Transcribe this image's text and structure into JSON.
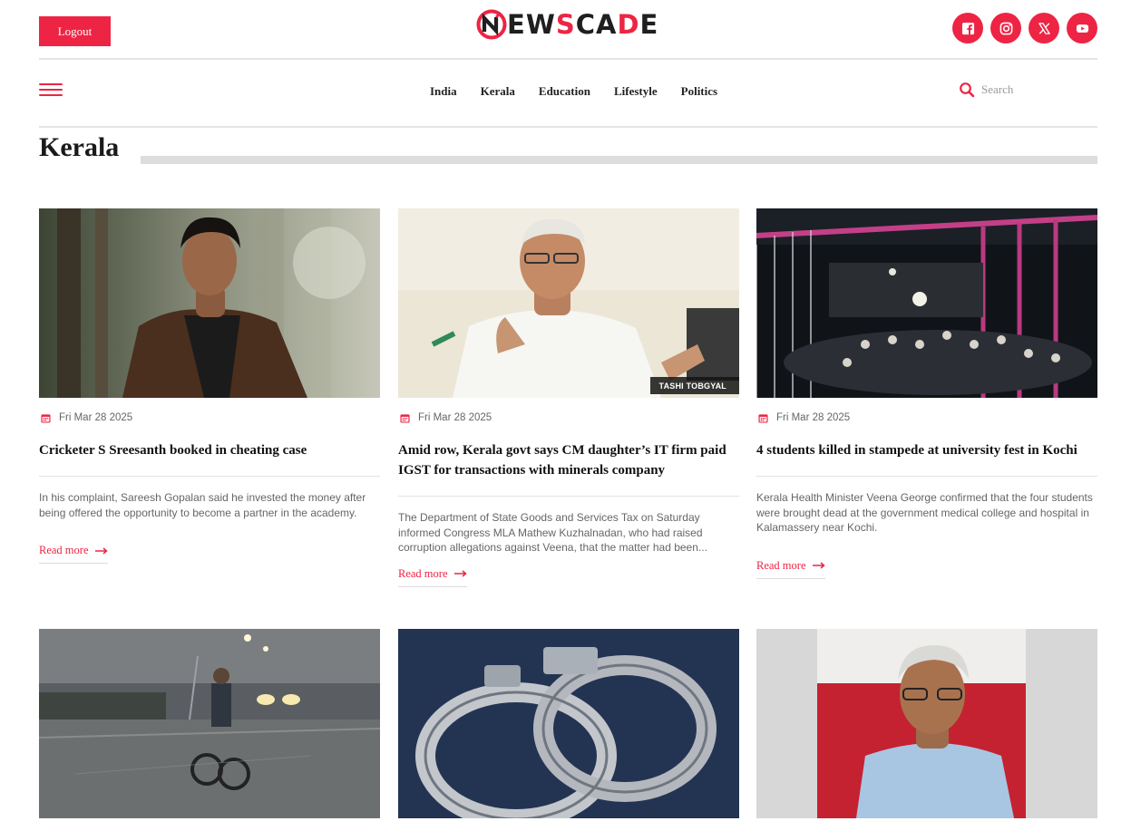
{
  "header": {
    "logout_label": "Logout",
    "logo_letters": [
      "N",
      "E",
      "W",
      "S",
      "C",
      "A",
      "D",
      "E"
    ],
    "socials": [
      "facebook-icon",
      "instagram-icon",
      "x-icon",
      "youtube-icon"
    ]
  },
  "nav": {
    "links": [
      "India",
      "Kerala",
      "Education",
      "Lifestyle",
      "Politics"
    ],
    "search_placeholder": "Search"
  },
  "section": {
    "title": "Kerala"
  },
  "articles": [
    {
      "date": "Fri Mar 28 2025",
      "title": "Cricketer S Sreesanth booked in cheating case",
      "excerpt": "In his complaint, Sareesh Gopalan said he invested the money after being offered the opportunity to become a partner in the academy.",
      "read_more": "Read more",
      "image": "man-in-leather-jacket-forest"
    },
    {
      "date": "Fri Mar 28 2025",
      "title": "Amid row, Kerala govt says CM daughter’s IT firm paid IGST for transactions with minerals company",
      "excerpt": "The Department of State Goods and Services Tax on Saturday informed Congress MLA Mathew Kuzhalnadan, who had raised corruption allegations against Veena, that the matter had been...",
      "read_more": "Read more",
      "image": "politician-gesturing",
      "photo_credit": "TASHI TOBGYAL"
    },
    {
      "date": "Fri Mar 28 2025",
      "title": "4 students killed in stampede at university fest in Kochi",
      "excerpt": "Kerala Health Minister Veena George confirmed that the four students were brought dead at the government medical college and hospital in Kalamassery near Kochi.",
      "read_more": "Read more",
      "image": "crowd-at-night-venue"
    },
    {
      "image": "cyclist-in-rain"
    },
    {
      "image": "handcuffs"
    },
    {
      "image": "man-with-glasses-portrait"
    }
  ],
  "colors": {
    "accent": "#ee2444",
    "logo_dark": "#1f1f1f"
  }
}
